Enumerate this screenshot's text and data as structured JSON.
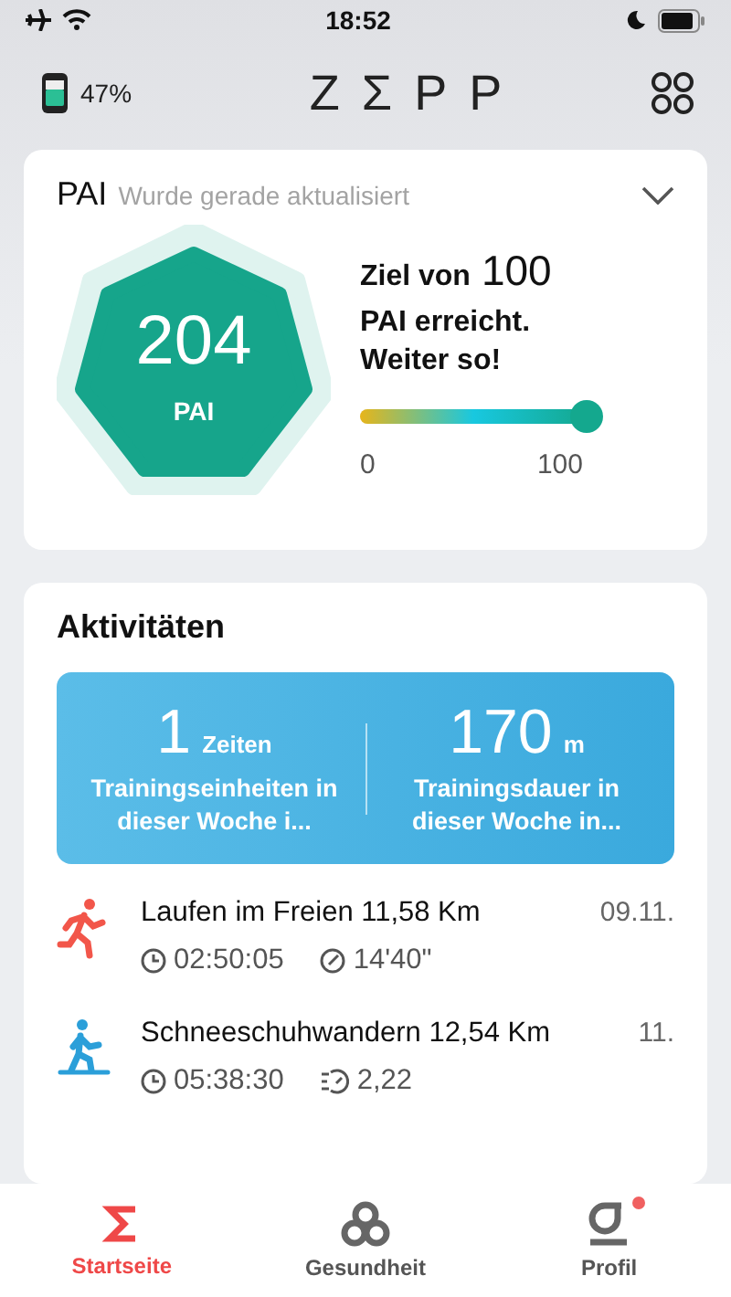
{
  "status_bar": {
    "time": "18:52"
  },
  "header": {
    "battery": "47%",
    "logo": "ZΣPP"
  },
  "pai": {
    "title": "PAI",
    "subtitle": "Wurde gerade aktualisiert",
    "value": "204",
    "unit": "PAI",
    "goal_prefix": "Ziel von",
    "goal_value": "100",
    "message": "PAI erreicht. Weiter so!",
    "level": 1,
    "min": "0",
    "max": "100"
  },
  "activities": {
    "title": "Aktivitäten",
    "stats": [
      {
        "value": "1",
        "unit": "Zeiten",
        "label": "Trainingseinheiten in dieser Woche i..."
      },
      {
        "value": "170",
        "unit": "m",
        "label": "Trainingsdauer in dieser Woche in..."
      }
    ],
    "items": [
      {
        "kind": "run",
        "title": "Laufen im Freien 11,58 Km",
        "date": "09.11.",
        "duration": "02:50:05",
        "metric": {
          "kind": "pace",
          "value": "14'40\""
        }
      },
      {
        "kind": "snowshoe",
        "title": "Schneeschuhwandern 12,54 Km",
        "date": "11.",
        "duration": "05:38:30",
        "metric": {
          "kind": "cadence",
          "value": "2,22"
        }
      }
    ]
  },
  "tabs": [
    {
      "kind": "home",
      "label": "Startseite",
      "selected": true,
      "notification": false
    },
    {
      "kind": "health",
      "label": "Gesundheit",
      "selected": false,
      "notification": false
    },
    {
      "kind": "profile",
      "label": "Profil",
      "selected": false,
      "notification": true
    }
  ]
}
